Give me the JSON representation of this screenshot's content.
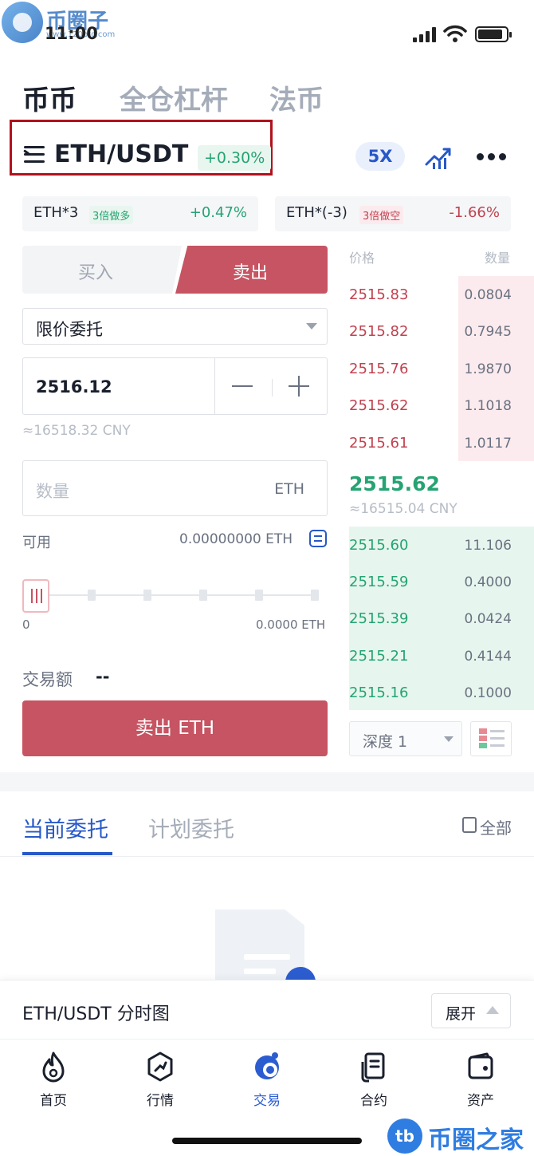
{
  "status_bar": {
    "time": "11:00"
  },
  "watermark": {
    "logo_text": "币圈子",
    "logo_sub": "www.120btc.com",
    "corner_badge": "tb",
    "corner_text": "币圈之家"
  },
  "top_tabs": [
    {
      "label": "币币",
      "active": true
    },
    {
      "label": "全仓杠杆",
      "active": false
    },
    {
      "label": "法币",
      "active": false
    }
  ],
  "pair": {
    "name": "ETH/USDT",
    "change": "+0.30%",
    "leverage": "5X"
  },
  "leveraged_tokens": [
    {
      "name": "ETH*3",
      "tag": "3倍做多",
      "change": "+0.47%"
    },
    {
      "name": "ETH*(-3)",
      "tag": "3倍做空",
      "change": "-1.66%"
    }
  ],
  "trade_form": {
    "buy_tab": "买入",
    "sell_tab": "卖出",
    "order_type": "限价委托",
    "price_value": "2516.12",
    "price_cny": "≈16518.32 CNY",
    "amount_placeholder": "数量",
    "amount_unit": "ETH",
    "available_label": "可用",
    "available_value": "0.00000000 ETH",
    "slider_percent": 0,
    "slider_min": "0",
    "slider_max": "0.0000 ETH",
    "volume_label": "交易额",
    "volume_value": "--",
    "action_button": "卖出 ETH"
  },
  "order_book": {
    "price_header": "价格",
    "qty_header": "数量",
    "asks": [
      {
        "price": "2515.83",
        "qty": "0.0804"
      },
      {
        "price": "2515.82",
        "qty": "0.7945"
      },
      {
        "price": "2515.76",
        "qty": "1.9870"
      },
      {
        "price": "2515.62",
        "qty": "1.1018"
      },
      {
        "price": "2515.61",
        "qty": "1.0117"
      }
    ],
    "last_price": "2515.62",
    "last_price_cny": "≈16515.04 CNY",
    "bids": [
      {
        "price": "2515.60",
        "qty": "11.106"
      },
      {
        "price": "2515.59",
        "qty": "0.4000"
      },
      {
        "price": "2515.39",
        "qty": "0.0424"
      },
      {
        "price": "2515.21",
        "qty": "0.4144"
      },
      {
        "price": "2515.16",
        "qty": "0.1000"
      }
    ],
    "depth_label": "深度 1"
  },
  "orders": {
    "tabs": [
      {
        "label": "当前委托",
        "active": true
      },
      {
        "label": "计划委托",
        "active": false
      }
    ],
    "all_label": "全部"
  },
  "chart_bar": {
    "label": "ETH/USDT 分时图",
    "expand_label": "展开"
  },
  "bottom_nav": [
    {
      "label": "首页",
      "icon": "flame-icon",
      "active": false
    },
    {
      "label": "行情",
      "icon": "market-icon",
      "active": false
    },
    {
      "label": "交易",
      "icon": "trade-icon",
      "active": true
    },
    {
      "label": "合约",
      "icon": "contract-icon",
      "active": false
    },
    {
      "label": "资产",
      "icon": "wallet-icon",
      "active": false
    }
  ],
  "colors": {
    "accent_blue": "#2658c8",
    "sell_red": "#c65462",
    "ask_red": "#c0424f",
    "bid_green": "#25a373",
    "highlight_box": "#b0121d"
  }
}
